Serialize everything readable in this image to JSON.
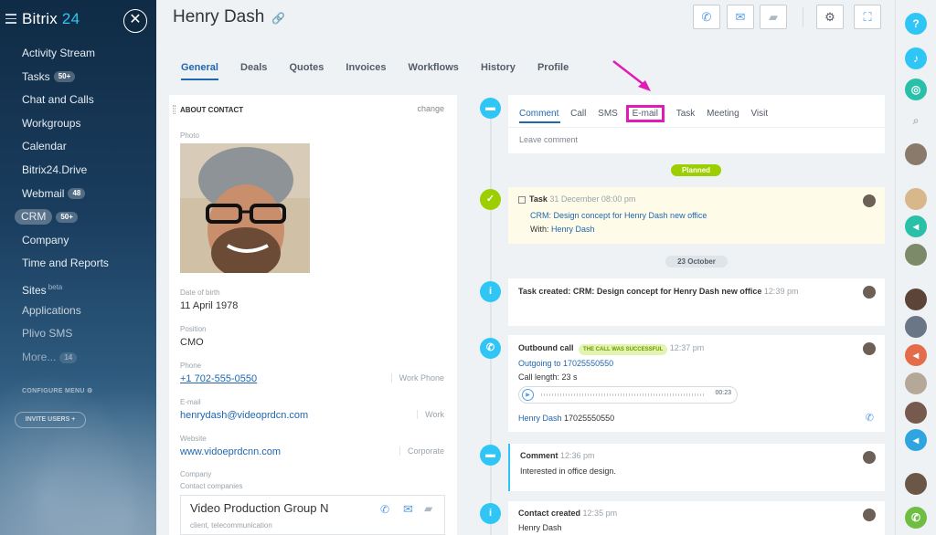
{
  "sidebar": {
    "logo_text": "Bitrix",
    "logo_num": "24",
    "items": [
      {
        "label": "Activity Stream"
      },
      {
        "label": "Tasks",
        "badge": "50+"
      },
      {
        "label": "Chat and Calls"
      },
      {
        "label": "Workgroups"
      },
      {
        "label": "Calendar"
      },
      {
        "label": "Bitrix24.Drive"
      },
      {
        "label": "Webmail",
        "badge": "48"
      },
      {
        "label": "CRM",
        "badge": "50+"
      },
      {
        "label": "Company"
      },
      {
        "label": "Time and Reports"
      },
      {
        "label": "Sites",
        "sup": "beta"
      },
      {
        "label": "Applications"
      },
      {
        "label": "Plivo SMS"
      },
      {
        "label": "More...",
        "badge": "14"
      }
    ],
    "configure_menu": "CONFIGURE MENU",
    "invite_users": "INVITE USERS"
  },
  "header": {
    "title": "Henry Dash",
    "tabs": [
      "General",
      "Deals",
      "Quotes",
      "Invoices",
      "Workflows",
      "History",
      "Profile"
    ]
  },
  "about": {
    "title": "ABOUT CONTACT",
    "change": "change",
    "photo_label": "Photo",
    "dob_label": "Date of birth",
    "dob": "11 April 1978",
    "position_label": "Position",
    "position": "CMO",
    "phone_label": "Phone",
    "phone": "+1 702-555-0550",
    "phone_type": "Work Phone",
    "email_label": "E-mail",
    "email": "henrydash@videoprdcn.com",
    "email_type": "Work",
    "website_label": "Website",
    "website": "www.vidoeprdcnn.com",
    "website_type": "Corporate",
    "company_label": "Company",
    "contact_companies": "Contact companies",
    "company_name": "Video Production Group N",
    "company_sub": "client, telecommunication"
  },
  "composer": {
    "tabs": [
      "Comment",
      "Call",
      "SMS",
      "E-mail",
      "Task",
      "Meeting",
      "Visit"
    ],
    "placeholder": "Leave comment"
  },
  "timeline": {
    "planned": "Planned",
    "task": {
      "title": "Task",
      "date": "31 December 08:00 pm",
      "subject": "CRM: Design concept for Henry Dash new office",
      "with_label": "With:",
      "with": "Henry Dash"
    },
    "date_divider": "23 October",
    "task_created": {
      "title": "Task created: CRM: Design concept for Henry Dash new office",
      "time": "12:39 pm"
    },
    "call": {
      "title": "Outbound call",
      "status": "THE CALL WAS SUCCESSFUL",
      "time": "12:37 pm",
      "direction": "Outgoing to 17025550550",
      "length": "Call length: 23 s",
      "duration": "00:23",
      "contact": "Henry Dash",
      "number": "17025550550"
    },
    "comment": {
      "title": "Comment",
      "time": "12:36 pm",
      "text": "Interested in office design."
    },
    "contact_created": {
      "title": "Contact created",
      "time": "12:35 pm",
      "name": "Henry Dash"
    }
  },
  "colors": {
    "accent": "#2067b0",
    "highlight": "#e11bb6",
    "green": "#9dcf00",
    "blue": "#2fc6f6"
  }
}
